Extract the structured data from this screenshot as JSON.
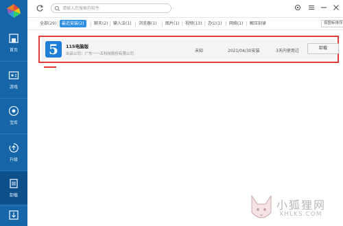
{
  "sidebar": {
    "items": [
      {
        "label": "首页",
        "icon": "home-icon"
      },
      {
        "label": "游戏",
        "icon": "gamepad-icon"
      },
      {
        "label": "宝库",
        "icon": "treasure-icon"
      },
      {
        "label": "升级",
        "icon": "upgrade-icon"
      },
      {
        "label": "卸载",
        "icon": "trash-icon"
      },
      {
        "label": "",
        "icon": "download-icon"
      }
    ]
  },
  "search": {
    "placeholder": "请输入您搜索的软件"
  },
  "tabs": [
    {
      "label": "全部(29)"
    },
    {
      "label": "最近安装(2)"
    },
    {
      "label": "聊天(2)"
    },
    {
      "label": "输入法(1)"
    },
    {
      "label": "浏览器(1)"
    },
    {
      "label": "图片(1)"
    },
    {
      "label": "视频(13)"
    },
    {
      "label": "办公(1)"
    },
    {
      "label": "网络(1)"
    },
    {
      "label": "解压刻录"
    }
  ],
  "sort": {
    "label": "按图标排序"
  },
  "app": {
    "icon_glyph": "5",
    "name": "115电脑版",
    "publisher": "出品公司：广东一一五科技股份有限公司",
    "size": "未知",
    "date": "2021/04/30安装",
    "usage": "3天内使用过",
    "uninstall_label": "卸载"
  },
  "watermark": {
    "line1": "小狐狸网",
    "line2": "XHLKS.COM"
  },
  "colors": {
    "sidebar": "#1565a8",
    "active_tab": "#2f8fe0",
    "highlight": "#e03a3a"
  }
}
